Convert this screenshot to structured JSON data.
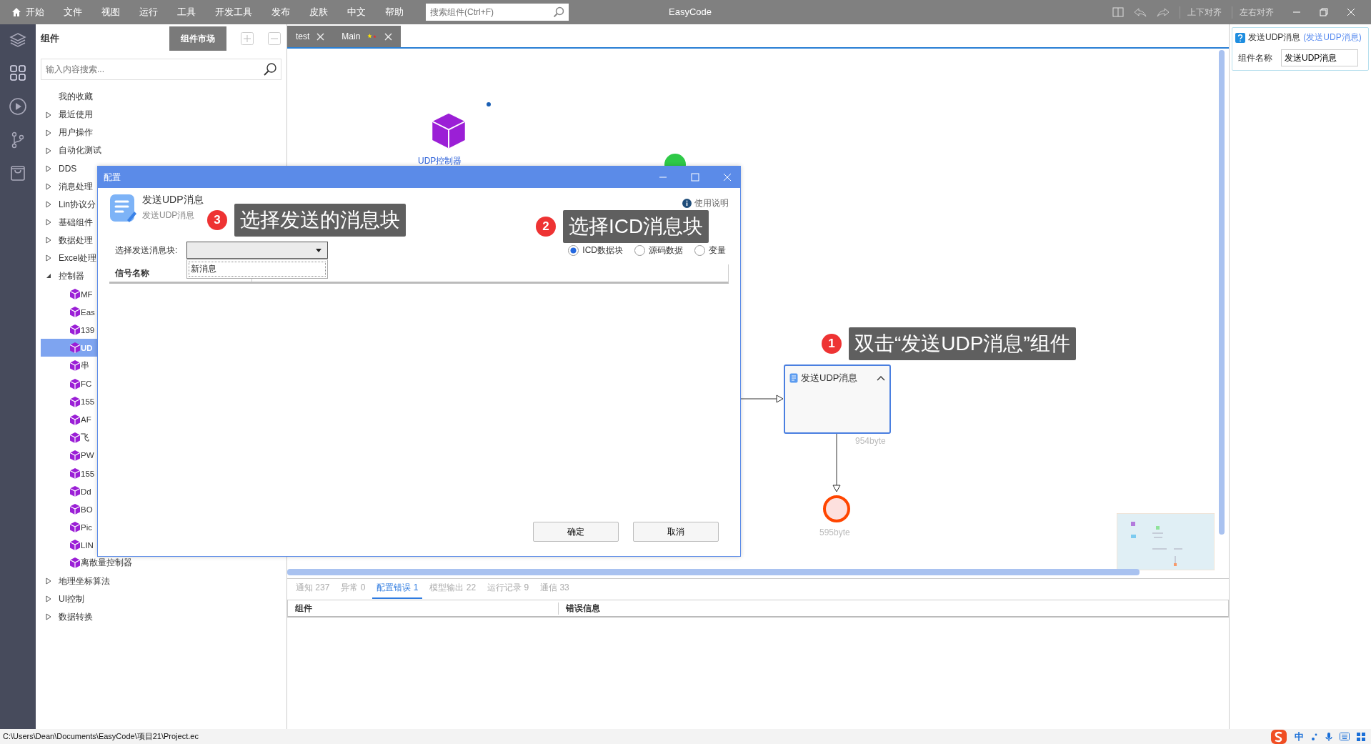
{
  "menu_bar": {
    "items": [
      {
        "label": "开始",
        "kind": "home"
      },
      {
        "label": "文件",
        "kind": "plain"
      },
      {
        "label": "视图",
        "kind": "plain"
      },
      {
        "label": "运行",
        "kind": "plain"
      },
      {
        "label": "工具",
        "kind": "plain"
      },
      {
        "label": "开发工具",
        "kind": "plain"
      },
      {
        "label": "发布",
        "kind": "plain"
      },
      {
        "label": "皮肤",
        "kind": "plain"
      },
      {
        "label": "中文",
        "kind": "plain"
      },
      {
        "label": "帮助",
        "kind": "plain"
      }
    ],
    "search": {
      "placeholder": "搜索组件(Ctrl+F)"
    },
    "app_title": "EasyCode",
    "toolbar": [
      "上下对齐",
      "左右对齐"
    ]
  },
  "sidebar": {
    "title": "组件",
    "market_button": "组件市场",
    "search": {
      "placeholder": "输入内容搜索..."
    },
    "tree": [
      {
        "label": "我的收藏",
        "kind": "plain"
      },
      {
        "label": "最近使用",
        "kind": "group",
        "expanded": false
      },
      {
        "label": "用户操作",
        "kind": "group",
        "expanded": false
      },
      {
        "label": "自动化测试",
        "kind": "group",
        "expanded": false
      },
      {
        "label": "DDS",
        "kind": "group",
        "expanded": false
      },
      {
        "label": "消息处理",
        "kind": "group",
        "expanded": false
      },
      {
        "label": "Lin协议分",
        "kind": "group",
        "expanded": false
      },
      {
        "label": "基础组件",
        "kind": "group",
        "expanded": false
      },
      {
        "label": "数据处理",
        "kind": "group",
        "expanded": false
      },
      {
        "label": "Excel处理",
        "kind": "group",
        "expanded": false
      },
      {
        "label": "控制器",
        "kind": "group",
        "expanded": true,
        "children": [
          {
            "label": "MF",
            "selected": false
          },
          {
            "label": "Eas",
            "selected": false
          },
          {
            "label": "139",
            "selected": false
          },
          {
            "label": "UD",
            "selected": true
          },
          {
            "label": "串",
            "selected": false
          },
          {
            "label": "FC",
            "selected": false
          },
          {
            "label": "155",
            "selected": false
          },
          {
            "label": "AF",
            "selected": false
          },
          {
            "label": "飞",
            "selected": false
          },
          {
            "label": "PW",
            "selected": false
          },
          {
            "label": "155",
            "selected": false
          },
          {
            "label": "Dd",
            "selected": false
          },
          {
            "label": "BO",
            "selected": false
          },
          {
            "label": "Pic",
            "selected": false
          },
          {
            "label": "LIN",
            "selected": false
          },
          {
            "label": "离散量控制器",
            "selected": false
          }
        ]
      },
      {
        "label": "地理坐标算法",
        "kind": "group",
        "expanded": false
      },
      {
        "label": "UI控制",
        "kind": "group",
        "expanded": false
      },
      {
        "label": "数据转换",
        "kind": "group",
        "expanded": false
      }
    ]
  },
  "tabs": [
    {
      "label": "test",
      "modified": false
    },
    {
      "label": "Main",
      "modified": true
    }
  ],
  "canvas": {
    "nodes": [
      {
        "kind": "controller",
        "label": "UDP控制器"
      },
      {
        "kind": "task",
        "label": "发送UDP消息",
        "size": "954byte"
      },
      {
        "kind": "end",
        "size": "595byte"
      }
    ]
  },
  "dialog": {
    "title": "配置",
    "component_name": "发送UDP消息",
    "component_subtitle": "发送UDP消息",
    "help": "使用说明",
    "select_label": "选择发送消息块:",
    "dropdown_options": [
      "新消息"
    ],
    "radios": [
      {
        "label": "ICD数据块",
        "selected": true
      },
      {
        "label": "源码数据",
        "selected": false
      },
      {
        "label": "变量",
        "selected": false
      }
    ],
    "columns": [
      "信号名称"
    ],
    "buttons": [
      "确定",
      "取消"
    ]
  },
  "annotations": [
    {
      "number": "3",
      "text": "选择发送的消息块"
    },
    {
      "number": "2",
      "text": "选择ICD消息块"
    },
    {
      "number": "1",
      "text": "双击“发送UDP消息”组件"
    }
  ],
  "properties": {
    "title": "发送UDP消息",
    "subtitle": "(发送UDP消息)",
    "field_label": "组件名称",
    "field_value": "发送UDP消息"
  },
  "output": {
    "tabs": [
      {
        "label": "通知 237",
        "selected": false
      },
      {
        "label": "异常 0",
        "selected": false
      },
      {
        "label": "配置错误 1",
        "selected": true
      },
      {
        "label": "模型输出 22",
        "selected": false
      },
      {
        "label": "运行记录 9",
        "selected": false
      },
      {
        "label": "通信 33",
        "selected": false
      }
    ],
    "columns": [
      "组件",
      "错误信息"
    ]
  },
  "status_bar": {
    "path": "C:\\Users\\Dean\\Documents\\EasyCode\\项目21\\Project.ec",
    "ime": "中"
  }
}
